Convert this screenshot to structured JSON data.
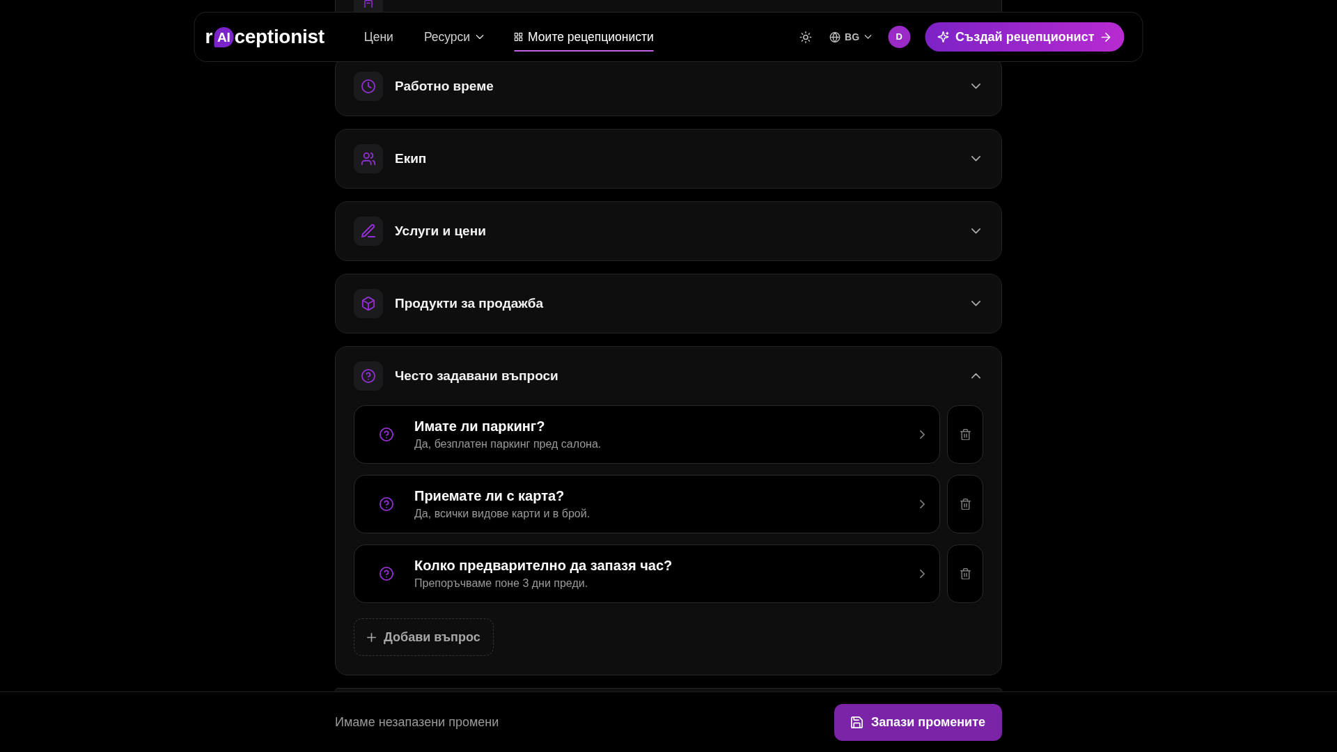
{
  "navbar": {
    "logo": {
      "prefix": "r",
      "badge": "AI",
      "suffix": "ceptionist"
    },
    "links": [
      {
        "label": "Цени",
        "kind": "plain",
        "selected": false
      },
      {
        "label": "Ресурси",
        "kind": "dropdown",
        "selected": false
      },
      {
        "label": "Моите рецепционисти",
        "kind": "icon",
        "selected": true
      }
    ],
    "language": "BG",
    "avatar": "D",
    "cta": "Създай рецепционист"
  },
  "sections": [
    {
      "kind": "cut_top"
    },
    {
      "kind": "accordion",
      "title": "Работно време",
      "expanded": false
    },
    {
      "kind": "accordion",
      "title": "Екип",
      "expanded": false
    },
    {
      "kind": "accordion",
      "title": "Услуги и цени",
      "expanded": false
    },
    {
      "kind": "accordion",
      "title": "Продукти за продажба",
      "expanded": false
    },
    {
      "kind": "accordion",
      "title": "Често задавани въпроси",
      "expanded": true,
      "questions": [
        {
          "question": "Имате ли паркинг?",
          "answer": "Да, безплатен паркинг пред салона."
        },
        {
          "question": "Приемате ли с карта?",
          "answer": "Да, всички видове карти и в брой."
        },
        {
          "question": "Колко предварително да запазя час?",
          "answer": "Препоръчваме поне 3 дни преди."
        }
      ],
      "add_button": "Добави въпрос"
    },
    {
      "kind": "cut_bottom"
    }
  ],
  "footer": {
    "status": "Имаме незапазени промени",
    "save_button": "Запази промените"
  }
}
